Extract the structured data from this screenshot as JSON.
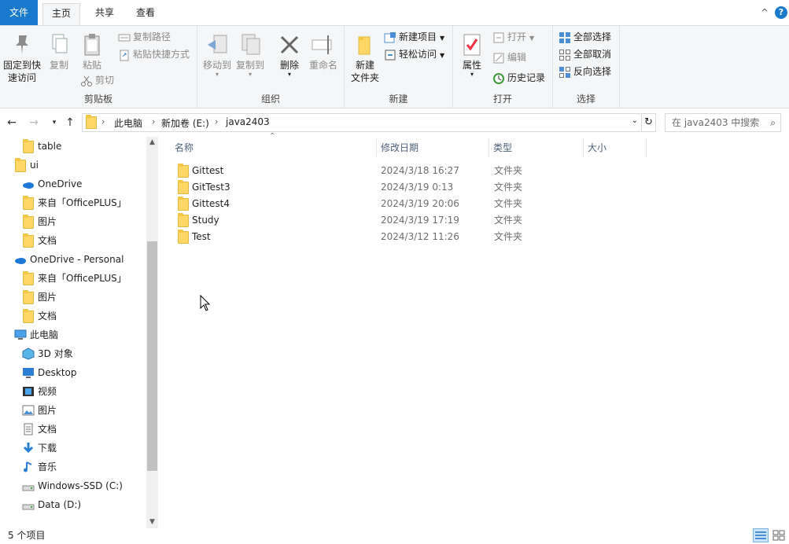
{
  "ribbon_tabs": {
    "file": "文件",
    "home": "主页",
    "share": "共享",
    "view": "查看"
  },
  "window": {
    "collapse": "^",
    "help": "?"
  },
  "clipboard": {
    "pin": "固定到快\n速访问",
    "copy": "复制",
    "paste": "粘贴",
    "copy_path": "复制路径",
    "paste_shortcut": "粘贴快捷方式",
    "cut": "剪切",
    "label": "剪贴板"
  },
  "organize": {
    "move_to": "移动到",
    "copy_to": "复制到",
    "delete": "删除",
    "rename": "重命名",
    "label": "组织"
  },
  "new": {
    "new_item": "新建项目",
    "easy_access": "轻松访问",
    "new_folder": "新建\n文件夹",
    "label": "新建"
  },
  "open": {
    "properties": "属性",
    "open": "打开",
    "edit": "编辑",
    "history": "历史记录",
    "label": "打开"
  },
  "select": {
    "select_all": "全部选择",
    "select_none": "全部取消",
    "invert": "反向选择",
    "label": "选择"
  },
  "address": {
    "crumbs": [
      "此电脑",
      "新加卷 (E:)",
      "java2403"
    ]
  },
  "search": {
    "placeholder": "在 java2403 中搜索"
  },
  "nav": {
    "items": [
      {
        "label": "table",
        "icon": "folder"
      },
      {
        "label": "ui",
        "icon": "folder"
      },
      {
        "label": "OneDrive",
        "icon": "onedrive"
      },
      {
        "label": "来自「OfficePLUS」",
        "icon": "folder"
      },
      {
        "label": "图片",
        "icon": "folder"
      },
      {
        "label": "文档",
        "icon": "folder"
      },
      {
        "label": "OneDrive - Personal",
        "icon": "onedrive"
      },
      {
        "label": "来自「OfficePLUS」",
        "icon": "folder"
      },
      {
        "label": "图片",
        "icon": "folder"
      },
      {
        "label": "文档",
        "icon": "folder"
      },
      {
        "label": "此电脑",
        "icon": "pc"
      },
      {
        "label": "3D 对象",
        "icon": "3d"
      },
      {
        "label": "Desktop",
        "icon": "desktop"
      },
      {
        "label": "视频",
        "icon": "video"
      },
      {
        "label": "图片",
        "icon": "pictures"
      },
      {
        "label": "文档",
        "icon": "documents"
      },
      {
        "label": "下载",
        "icon": "download"
      },
      {
        "label": "音乐",
        "icon": "music"
      },
      {
        "label": "Windows-SSD (C:)",
        "icon": "drive"
      },
      {
        "label": "Data (D:)",
        "icon": "drive"
      }
    ]
  },
  "columns": {
    "name": "名称",
    "date": "修改日期",
    "type": "类型",
    "size": "大小"
  },
  "files": [
    {
      "name": "Gittest",
      "date": "2024/3/18 16:27",
      "type": "文件夹"
    },
    {
      "name": "GitTest3",
      "date": "2024/3/19 0:13",
      "type": "文件夹"
    },
    {
      "name": "Gittest4",
      "date": "2024/3/19 20:06",
      "type": "文件夹"
    },
    {
      "name": "Study",
      "date": "2024/3/19 17:19",
      "type": "文件夹"
    },
    {
      "name": "Test",
      "date": "2024/3/12 11:26",
      "type": "文件夹"
    }
  ],
  "status": {
    "count": "5 个项目"
  },
  "colors": {
    "accent": "#1979ca",
    "folder": "#ffd766",
    "ribbon_bg": "#f5f6f7"
  }
}
